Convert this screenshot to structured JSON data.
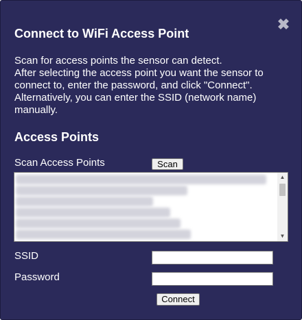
{
  "dialog": {
    "close_symbol": "✖",
    "title": "Connect to WiFi Access Point",
    "description_lines": [
      "Scan for access points the sensor can detect.",
      "After selecting the access point you want the sensor to",
      "connect to, enter the password, and click \"Connect\".",
      "Alternatively, you can enter the SSID (network name)",
      "manually."
    ]
  },
  "access_points": {
    "heading": "Access Points",
    "scan_label": "Scan Access Points",
    "scan_button": "Scan",
    "list_note": "access point names are blurred/obscured in the screenshot",
    "scroll_up_symbol": "▲",
    "scroll_down_symbol": "▼"
  },
  "form": {
    "ssid_label": "SSID",
    "ssid_value": "",
    "password_label": "Password",
    "password_value": "",
    "connect_button": "Connect"
  },
  "colors": {
    "dialog_background": "#2b2a5a",
    "text": "#ffffff",
    "close_icon": "#b9b9c9"
  }
}
